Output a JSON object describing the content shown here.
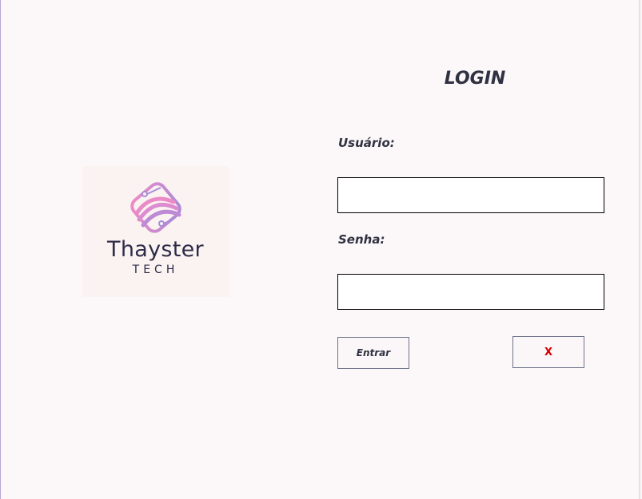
{
  "logo": {
    "name": "Thayster",
    "subtitle": "TECH"
  },
  "login": {
    "title": "LOGIN",
    "username_label": "Usuário:",
    "password_label": "Senha:",
    "username_value": "",
    "password_value": "",
    "enter_button": "Entrar",
    "close_button": "X"
  },
  "colors": {
    "background": "#fcf7f8",
    "text": "#2f3242",
    "close_accent": "#d40000",
    "logo_pink": "#e58acb",
    "logo_purple": "#a98bd7"
  }
}
